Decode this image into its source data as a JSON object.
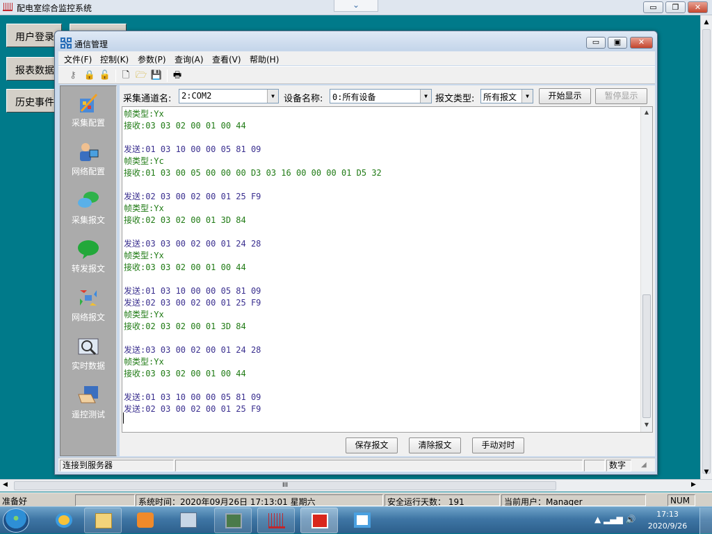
{
  "app": {
    "title": "配电室综合监控系统",
    "tab_dropdown_icon": "chevron-down-icon",
    "controls": {
      "minimize": "▭",
      "restore": "❐",
      "close": "✕"
    }
  },
  "left_buttons": [
    "用户登录",
    "报表数据",
    "历史事件"
  ],
  "child_window": {
    "title": "通信管理",
    "controls": {
      "minimize": "▭",
      "restore": "▣",
      "close": "✕"
    },
    "menu": [
      "文件(F)",
      "控制(K)",
      "参数(P)",
      "查询(A)",
      "查看(V)",
      "帮助(H)"
    ],
    "toolbar_icons": [
      "key-icon",
      "lock-icon",
      "unlock-icon",
      "new-file-icon",
      "open-folder-icon",
      "save-icon",
      "print-icon"
    ],
    "sidebar": [
      {
        "label": "采集配置",
        "icon": "collect-config-icon"
      },
      {
        "label": "网络配置",
        "icon": "network-config-icon"
      },
      {
        "label": "采集报文",
        "icon": "collect-message-icon"
      },
      {
        "label": "转发报文",
        "icon": "forward-message-icon"
      },
      {
        "label": "网络报文",
        "icon": "network-message-icon"
      },
      {
        "label": "实时数据",
        "icon": "realtime-data-icon"
      },
      {
        "label": "遥控测试",
        "icon": "remote-control-icon"
      }
    ],
    "filters": {
      "channel_label": "采集通道名:",
      "channel_value": "2:COM2",
      "device_label": "设备名称:",
      "device_value": "0:所有设备",
      "msg_type_label": "报文类型:",
      "msg_type_value": "所有报文",
      "start_button": "开始显示",
      "pause_button": "暂停显示"
    },
    "log": [
      {
        "type": "frame",
        "text": "帧类型:Yx"
      },
      {
        "type": "recv",
        "text": "接收:03 03 02 00 01 00 44"
      },
      {
        "type": "blank",
        "text": ""
      },
      {
        "type": "send",
        "text": "发送:01 03 10 00 00 05 81 09"
      },
      {
        "type": "frame",
        "text": "帧类型:Yc"
      },
      {
        "type": "recv",
        "text": "接收:01 03 00 05 00 00 00 D3 03 16 00 00 00 01 D5 32"
      },
      {
        "type": "blank",
        "text": ""
      },
      {
        "type": "send",
        "text": "发送:02 03 00 02 00 01 25 F9"
      },
      {
        "type": "frame",
        "text": "帧类型:Yx"
      },
      {
        "type": "recv",
        "text": "接收:02 03 02 00 01 3D 84"
      },
      {
        "type": "blank",
        "text": ""
      },
      {
        "type": "send",
        "text": "发送:03 03 00 02 00 01 24 28"
      },
      {
        "type": "frame",
        "text": "帧类型:Yx"
      },
      {
        "type": "recv",
        "text": "接收:03 03 02 00 01 00 44"
      },
      {
        "type": "blank",
        "text": ""
      },
      {
        "type": "send",
        "text": "发送:01 03 10 00 00 05 81 09"
      },
      {
        "type": "send",
        "text": "发送:02 03 00 02 00 01 25 F9"
      },
      {
        "type": "frame",
        "text": "帧类型:Yx"
      },
      {
        "type": "recv",
        "text": "接收:02 03 02 00 01 3D 84"
      },
      {
        "type": "blank",
        "text": ""
      },
      {
        "type": "send",
        "text": "发送:03 03 00 02 00 01 24 28"
      },
      {
        "type": "frame",
        "text": "帧类型:Yx"
      },
      {
        "type": "recv",
        "text": "接收:03 03 02 00 01 00 44"
      },
      {
        "type": "blank",
        "text": ""
      },
      {
        "type": "send",
        "text": "发送:01 03 10 00 00 05 81 09"
      },
      {
        "type": "send",
        "text": "发送:02 03 00 02 00 01 25 F9"
      }
    ],
    "bottom_buttons": {
      "save": "保存报文",
      "clear": "清除报文",
      "manual": "手动对时"
    },
    "status": {
      "connection": "连接到服务器",
      "numlock": "数字"
    }
  },
  "main_status": {
    "ready": "准备好",
    "system_time": "系统时间：2020年09月26日  17:13:01   星期六",
    "uptime": "安全运行天数： 191",
    "current_user": "当前用户：Manager",
    "numlock": "NUM"
  },
  "taskbar": {
    "time": "17:13",
    "date": "2020/9/26",
    "apps": [
      "ie-icon",
      "explorer-icon",
      "media-player-icon",
      "keyboard-pc-icon",
      "network-device-icon",
      "monitor-app-icon",
      "red-app-icon",
      "comm-manager-icon"
    ],
    "tray": "▲ ▂▄▆ 🔊"
  }
}
